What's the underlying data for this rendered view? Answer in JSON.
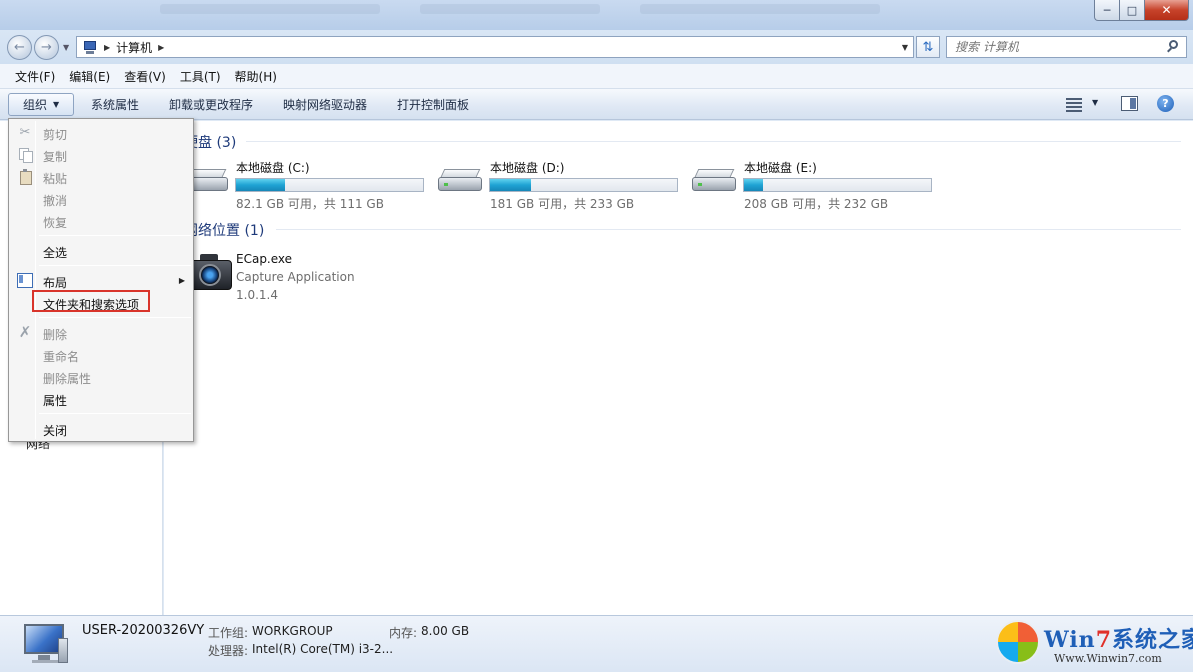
{
  "window": {
    "controls": {
      "minimize_icon": "minimize-icon",
      "maximize_icon": "maximize-icon",
      "close_icon": "close-icon"
    }
  },
  "address": {
    "crumb": "计算机",
    "search_placeholder": "搜索 计算机"
  },
  "menubar": {
    "file": "文件(F)",
    "edit": "编辑(E)",
    "view": "查看(V)",
    "tools": "工具(T)",
    "help": "帮助(H)"
  },
  "commandbar": {
    "organize": "组织",
    "system_properties": "系统属性",
    "uninstall": "卸载或更改程序",
    "map_drive": "映射网络驱动器",
    "control_panel": "打开控制面板"
  },
  "groups": {
    "hard_disks": "硬盘 (3)",
    "network_locations": "网络位置 (1)"
  },
  "drives": [
    {
      "name": "本地磁盘 (C:)",
      "free": "82.1 GB 可用，共 111 GB",
      "used_fraction": 0.26
    },
    {
      "name": "本地磁盘 (D:)",
      "free": "181 GB 可用，共 233 GB",
      "used_fraction": 0.22
    },
    {
      "name": "本地磁盘 (E:)",
      "free": "208 GB 可用，共 232 GB",
      "used_fraction": 0.1
    }
  ],
  "network_item": {
    "name": "ECap.exe",
    "description": "Capture Application",
    "version": "1.0.1.4"
  },
  "navpane": {
    "network": "网络"
  },
  "dropdown": {
    "cut": "剪切",
    "copy": "复制",
    "paste": "粘贴",
    "undo": "撤消",
    "redo": "恢复",
    "select_all": "全选",
    "layout": "布局",
    "folder_options": "文件夹和搜索选项",
    "delete": "删除",
    "rename": "重命名",
    "remove_properties": "删除属性",
    "properties": "属性",
    "close": "关闭"
  },
  "details": {
    "computer_name": "USER-20200326VY",
    "workgroup_label": "工作组:",
    "workgroup_value": "WORKGROUP",
    "memory_label": "内存:",
    "memory_value": "8.00 GB",
    "processor_label": "处理器:",
    "processor_value": "Intel(R) Core(TM) i3-2..."
  },
  "watermark": {
    "brand_a": "Win",
    "brand_seven": "7",
    "brand_b": "系统之家",
    "url": "Www.Winwin7.com"
  }
}
